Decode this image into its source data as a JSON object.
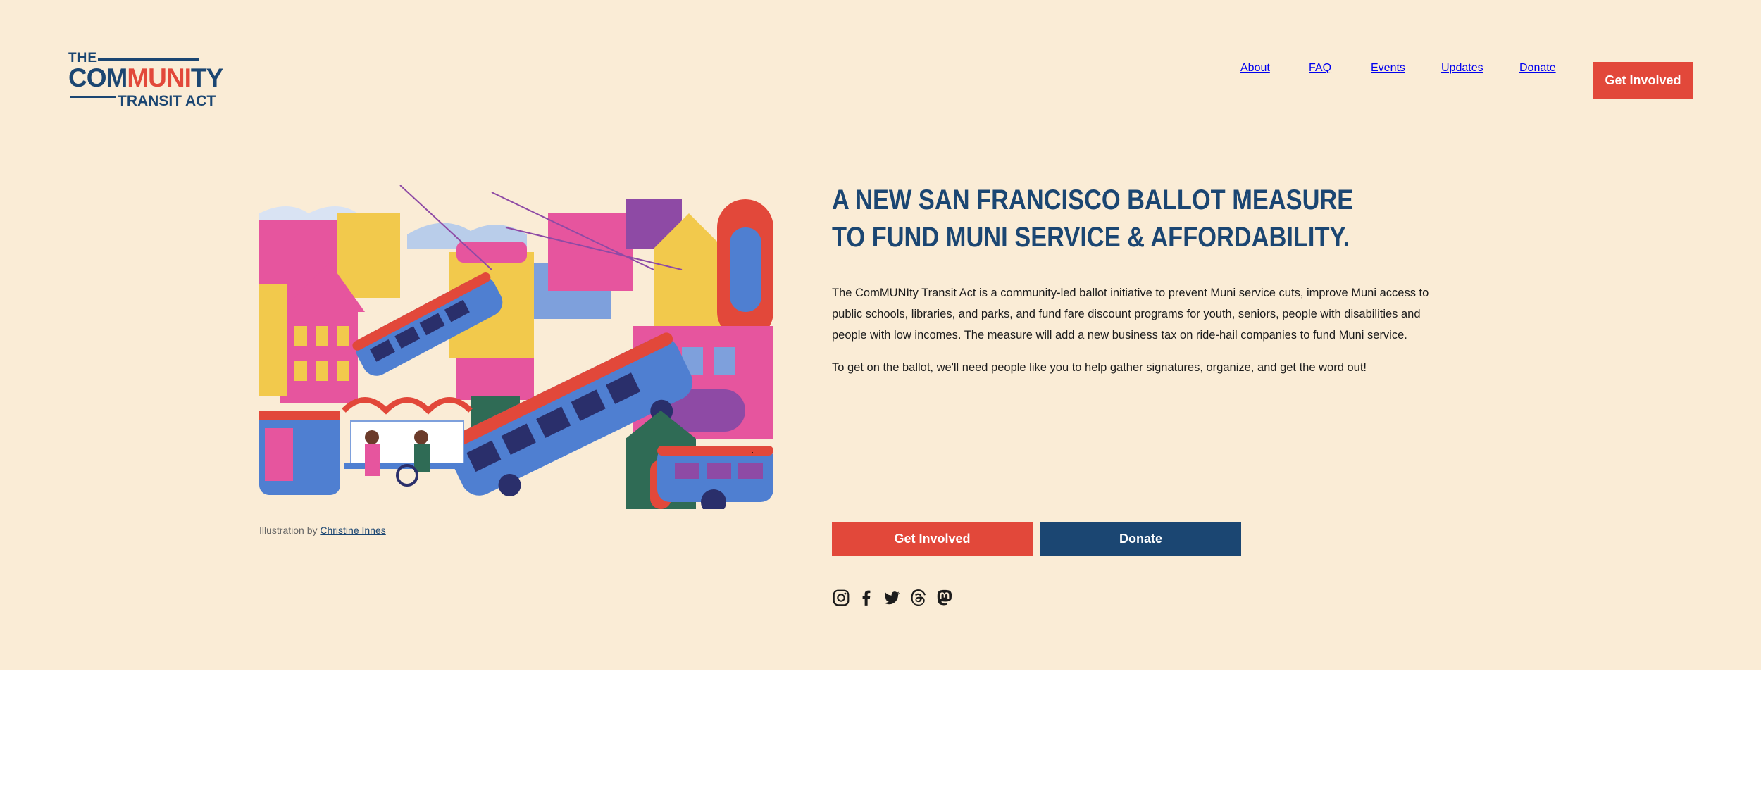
{
  "logo": {
    "line1": "THE",
    "word_a": "COM",
    "word_b": "MUNI",
    "word_c": "TY",
    "line3": "TRANSIT ACT"
  },
  "nav": {
    "items": [
      "About",
      "FAQ",
      "Events",
      "Updates",
      "Donate"
    ],
    "cta": "Get Involved"
  },
  "hero": {
    "headline": "A NEW SAN FRANCISCO BALLOT MEASURE TO FUND MUNI SERVICE & AFFORDABILITY.",
    "paragraph1": "The ComMUNIty Transit Act is a community-led ballot initiative to prevent Muni service cuts, improve Muni access to public schools, libraries, and parks, and fund fare discount programs for youth, seniors, people with disabilities and people with low incomes. The measure will add a new business tax on ride-hail companies to fund Muni service.",
    "paragraph2": "To get on the ballot, we'll need people like you to help gather signatures, organize, and get the word out!",
    "caption_prefix": "Illustration by",
    "caption_link": "Christine Innes",
    "primary_button": "Get Involved",
    "secondary_button": "Donate"
  },
  "social": [
    "instagram-icon",
    "facebook-icon",
    "twitter-icon",
    "threads-icon",
    "mastodon-icon"
  ],
  "colors": {
    "background": "#faecd6",
    "navy": "#1b4672",
    "red": "#e2483a"
  }
}
